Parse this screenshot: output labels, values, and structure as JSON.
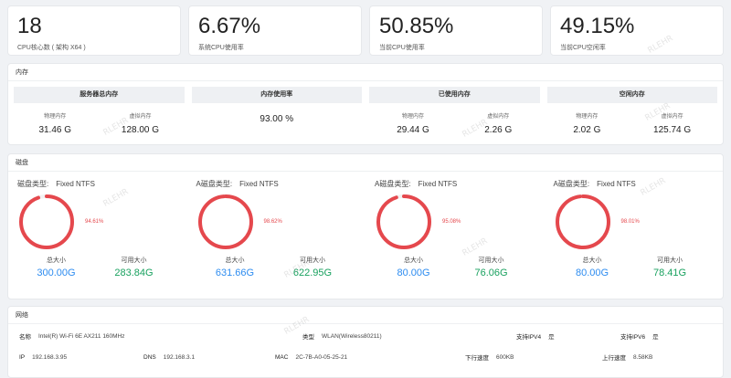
{
  "stats": [
    {
      "value": "18",
      "label": "CPU核心数 ( 架构 X64 )"
    },
    {
      "value": "6.67%",
      "label": "系统CPU使用率"
    },
    {
      "value": "50.85%",
      "label": "当前CPU使用率"
    },
    {
      "value": "49.15%",
      "label": "当前CPU空闲率"
    }
  ],
  "memory": {
    "title": "内存",
    "total": {
      "title": "服务器总内存",
      "physical_label": "物理内存",
      "physical": "31.46 G",
      "virtual_label": "虚拟内存",
      "virtual": "128.00 G"
    },
    "usage": {
      "title": "内存使用率",
      "value": "93.00 %"
    },
    "used": {
      "title": "已使用内存",
      "physical_label": "物理内存",
      "physical": "29.44 G",
      "virtual_label": "虚拟内存",
      "virtual": "2.26 G"
    },
    "free": {
      "title": "空闲内存",
      "physical_label": "物理内存",
      "physical": "2.02 G",
      "virtual_label": "虚拟内存",
      "virtual": "125.74 G"
    }
  },
  "disk": {
    "title": "磁盘",
    "type_label": "磁盘类型:",
    "total_label": "总大小",
    "free_label": "可用大小",
    "colors": {
      "ring": "#e5484d",
      "track": "#f2f2f2",
      "total": "#2d8cf0",
      "free": "#19a15f"
    },
    "items": [
      {
        "prefix": "",
        "fs": "Fixed NTFS",
        "percent": 94.61,
        "percent_text": "94.61%",
        "total": "300.00G",
        "free": "283.84G"
      },
      {
        "prefix": "A",
        "fs": "Fixed NTFS",
        "percent": 98.62,
        "percent_text": "98.62%",
        "total": "631.66G",
        "free": "622.95G"
      },
      {
        "prefix": "A",
        "fs": "Fixed NTFS",
        "percent": 95.08,
        "percent_text": "95.08%",
        "total": "80.00G",
        "free": "76.06G"
      },
      {
        "prefix": "A",
        "fs": "Fixed NTFS",
        "percent": 98.01,
        "percent_text": "98.01%",
        "total": "80.00G",
        "free": "78.41G"
      }
    ]
  },
  "network": {
    "title": "网络",
    "name_label": "名称",
    "name": "Intel(R) Wi-Fi 6E AX211 160MHz",
    "type_label": "类型",
    "type": "WLAN(Wireless80211)",
    "ipv4_label": "支持IPV4",
    "ipv4": "是",
    "ipv6_label": "支持IPV6",
    "ipv6": "是",
    "ip_label": "IP",
    "ip": "192.168.3.95",
    "dns_label": "DNS",
    "dns": "192.168.3.1",
    "mac_label": "MAC",
    "mac": "2C-7B-A0-05-25-21",
    "down_label": "下行速度",
    "down": "600KB",
    "up_label": "上行速度",
    "up": "8.58KB"
  },
  "watermark": "RLEHR"
}
